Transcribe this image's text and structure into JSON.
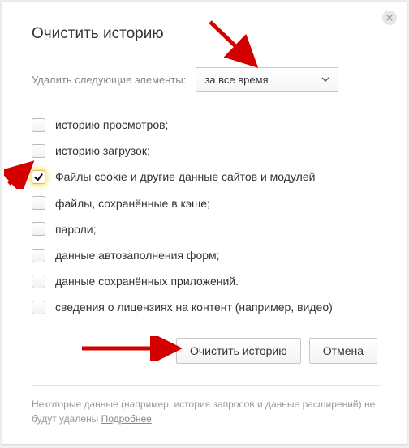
{
  "title": "Очистить историю",
  "time": {
    "label": "Удалить следующие элементы:",
    "selected": "за все время"
  },
  "options": [
    {
      "label": "историю просмотров;",
      "checked": false
    },
    {
      "label": "историю загрузок;",
      "checked": false
    },
    {
      "label": "Файлы cookie и другие данные сайтов и модулей",
      "checked": true
    },
    {
      "label": "файлы, сохранённые в кэше;",
      "checked": false
    },
    {
      "label": "пароли;",
      "checked": false
    },
    {
      "label": "данные автозаполнения форм;",
      "checked": false
    },
    {
      "label": "данные сохранённых приложений.",
      "checked": false
    },
    {
      "label": "сведения о лицензиях на контент (например, видео)",
      "checked": false
    }
  ],
  "buttons": {
    "clear": "Очистить историю",
    "cancel": "Отмена"
  },
  "footer": {
    "text": "Некоторые данные (например, история запросов и данные расширений) не будут удалены ",
    "link": "Подробнее"
  }
}
